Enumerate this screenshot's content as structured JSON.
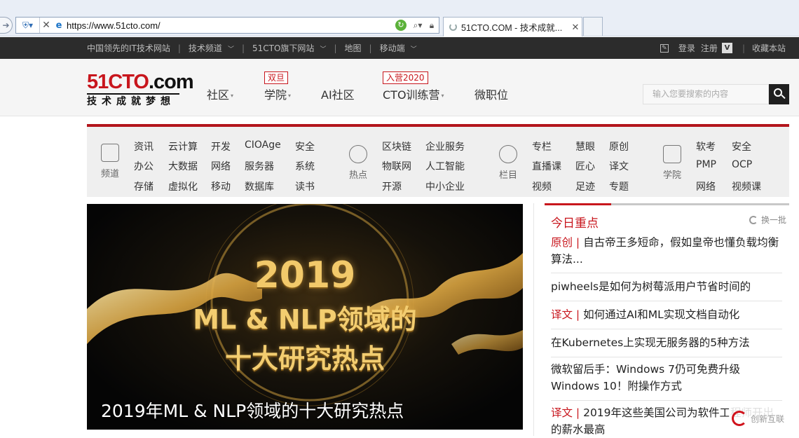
{
  "browser": {
    "url": "https://www.51cto.com/",
    "tab_title": "51CTO.COM - 技术成就...",
    "tab_close": "✕",
    "stop": "✕"
  },
  "topbar": {
    "items": [
      "中国领先的IT技术网站",
      "技术频道",
      "51CTO旗下网站",
      "地图",
      "移动端"
    ],
    "login": "登录",
    "register": "注册",
    "v_badge": "V",
    "bookmark": "收藏本站"
  },
  "header": {
    "logo_main_a": "51CTO",
    "logo_main_b": ".com",
    "logo_sub": "技术成就梦想",
    "nav": [
      "社区",
      "学院",
      "AI社区",
      "CTO训练营",
      "微职位"
    ],
    "badge_xueyuan": "双旦",
    "badge_cto": "入营2020",
    "search_placeholder": "输入您要搜索的内容"
  },
  "channels": {
    "groups": [
      {
        "label": "频道",
        "icon": "channel-doc-icon",
        "links": [
          "资讯",
          "云计算",
          "开发",
          "CIOAge",
          "安全",
          "办公",
          "大数据",
          "网络",
          "服务器",
          "系统",
          "存储",
          "虚拟化",
          "移动",
          "数据库",
          "读书"
        ]
      },
      {
        "label": "热点",
        "icon": "hotspot-pointer-icon",
        "links": [
          "区块链",
          "企业服务",
          "物联网",
          "人工智能",
          "开源",
          "中小企业"
        ]
      },
      {
        "label": "栏目",
        "icon": "column-star-icon",
        "links": [
          "专栏",
          "慧眼",
          "原创",
          "直播课",
          "匠心",
          "译文",
          "视频",
          "足迹",
          "专题"
        ]
      },
      {
        "label": "学院",
        "icon": "academy-book-icon",
        "links": [
          "软考",
          "安全",
          "PMP",
          "OCP",
          "网络",
          "视频课"
        ]
      }
    ]
  },
  "banner": {
    "line1": "2019",
    "line2": "ML & NLP领域的",
    "line3": "十大研究热点",
    "caption": "2019年ML & NLP领域的十大研究热点"
  },
  "news": {
    "title": "今日重点",
    "refresh": "换一批",
    "items": [
      {
        "tag": "原创 | ",
        "text": "自古帝王多短命，假如皇帝也懂负载均衡算法..."
      },
      {
        "tag": "",
        "text": "piwheels是如何为树莓派用户节省时间的"
      },
      {
        "tag": "译文 | ",
        "text": "如何通过AI和ML实现文档自动化"
      },
      {
        "tag": "",
        "text": "在Kubernetes上实现无服务器的5种方法"
      },
      {
        "tag": "",
        "text": "微软留后手：Windows 7仍可免费升级Windows 10！附操作方式"
      },
      {
        "tag": "译文 | ",
        "text": "2019年这些美国公司为软件工程师开出的薪水最高"
      }
    ]
  },
  "watermark": "创新互联"
}
